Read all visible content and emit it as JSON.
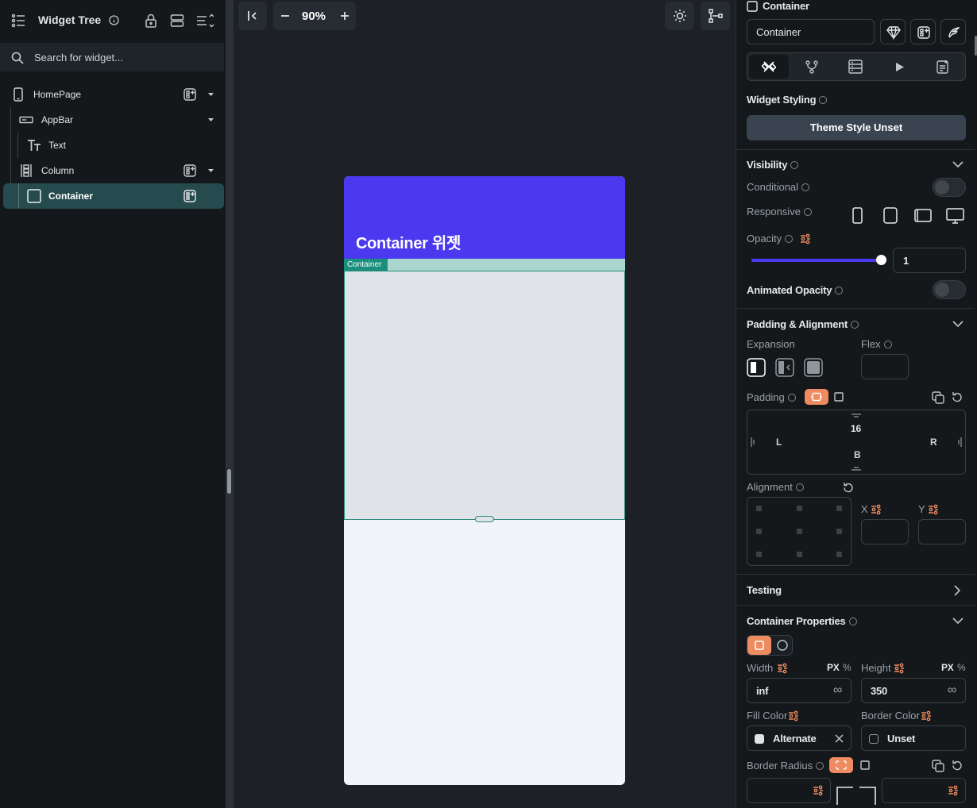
{
  "left_panel": {
    "title": "Widget Tree",
    "search_placeholder": "Search for widget...",
    "tree": [
      {
        "label": "HomePage",
        "icon": "phone-icon",
        "has_add": true,
        "has_caret": true,
        "selected": false
      },
      {
        "label": "AppBar",
        "icon": "appbar-icon",
        "has_add": false,
        "has_caret": true,
        "selected": false
      },
      {
        "label": "Text",
        "icon": "text-icon",
        "has_add": false,
        "has_caret": false,
        "selected": false
      },
      {
        "label": "Column",
        "icon": "column-icon",
        "has_add": true,
        "has_caret": true,
        "selected": false
      },
      {
        "label": "Container",
        "icon": "container-icon",
        "has_add": true,
        "has_caret": false,
        "selected": true
      }
    ]
  },
  "canvas": {
    "zoom": "90%",
    "appbar_title": "Container 위젯",
    "selected_badge": "Container",
    "colors": {
      "appbar": "#4b39ef",
      "container": "#e0e3e7",
      "page_bg": "#f1f4f8",
      "selection": "#2d8c7e"
    }
  },
  "right_panel": {
    "widget_type": "Container",
    "widget_name": "Container",
    "widget_styling_label": "Widget Styling",
    "theme_style_button": "Theme Style Unset",
    "visibility": {
      "title": "Visibility",
      "conditional_label": "Conditional",
      "responsive_label": "Responsive",
      "opacity_label": "Opacity",
      "opacity_value": "1",
      "opacity_fraction": 1.0,
      "animated_opacity_label": "Animated Opacity"
    },
    "padding_alignment": {
      "title": "Padding & Alignment",
      "expansion_label": "Expansion",
      "flex_label": "Flex",
      "padding_label": "Padding",
      "padding_top": "16",
      "padding_left": "L",
      "padding_right": "R",
      "padding_bottom": "B",
      "alignment_label": "Alignment",
      "x_label": "X",
      "y_label": "Y"
    },
    "testing_label": "Testing",
    "container_properties": {
      "title": "Container Properties",
      "width_label": "Width",
      "width_units": "PX",
      "width_alt_unit": "%",
      "width_value": "inf",
      "height_label": "Height",
      "height_units": "PX",
      "height_alt_unit": "%",
      "height_value": "350",
      "infinity_symbol": "∞",
      "fill_color_label": "Fill Color",
      "fill_color_value": "Alternate",
      "border_color_label": "Border Color",
      "border_color_value": "Unset",
      "border_radius_label": "Border Radius"
    },
    "accent_color": "#ee8b60"
  }
}
